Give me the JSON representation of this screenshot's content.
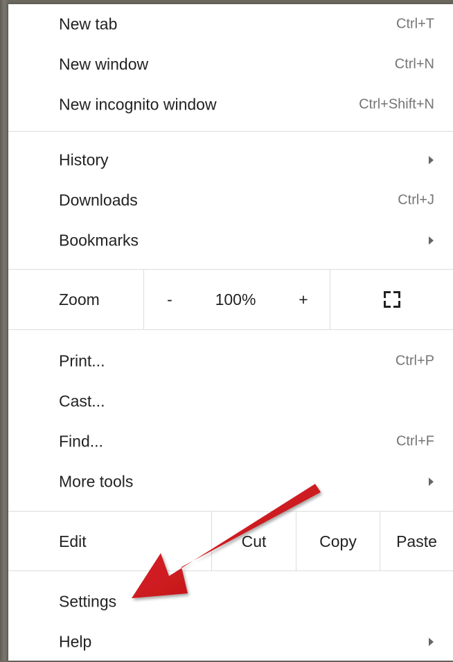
{
  "menu": {
    "section1": [
      {
        "label": "New tab",
        "shortcut": "Ctrl+T"
      },
      {
        "label": "New window",
        "shortcut": "Ctrl+N"
      },
      {
        "label": "New incognito window",
        "shortcut": "Ctrl+Shift+N"
      }
    ],
    "section2": [
      {
        "label": "History",
        "shortcut": ""
      },
      {
        "label": "Downloads",
        "shortcut": "Ctrl+J"
      },
      {
        "label": "Bookmarks",
        "shortcut": ""
      }
    ],
    "zoom": {
      "label": "Zoom",
      "minus": "-",
      "value": "100%",
      "plus": "+"
    },
    "section3": [
      {
        "label": "Print...",
        "shortcut": "Ctrl+P"
      },
      {
        "label": "Cast...",
        "shortcut": ""
      },
      {
        "label": "Find...",
        "shortcut": "Ctrl+F"
      },
      {
        "label": "More tools",
        "shortcut": ""
      }
    ],
    "edit": {
      "label": "Edit",
      "cut": "Cut",
      "copy": "Copy",
      "paste": "Paste"
    },
    "section4": [
      {
        "label": "Settings",
        "shortcut": ""
      },
      {
        "label": "Help",
        "shortcut": ""
      }
    ]
  },
  "icons": {
    "submenu": "triangle-right-icon",
    "fullscreen": "fullscreen-icon",
    "annotation": "red-pointer-arrow"
  },
  "colors": {
    "menu_bg": "#ffffff",
    "text": "#222222",
    "shortcut_text": "#757575",
    "separator": "#dcdcdc",
    "annotation_arrow": "#d3171c"
  }
}
